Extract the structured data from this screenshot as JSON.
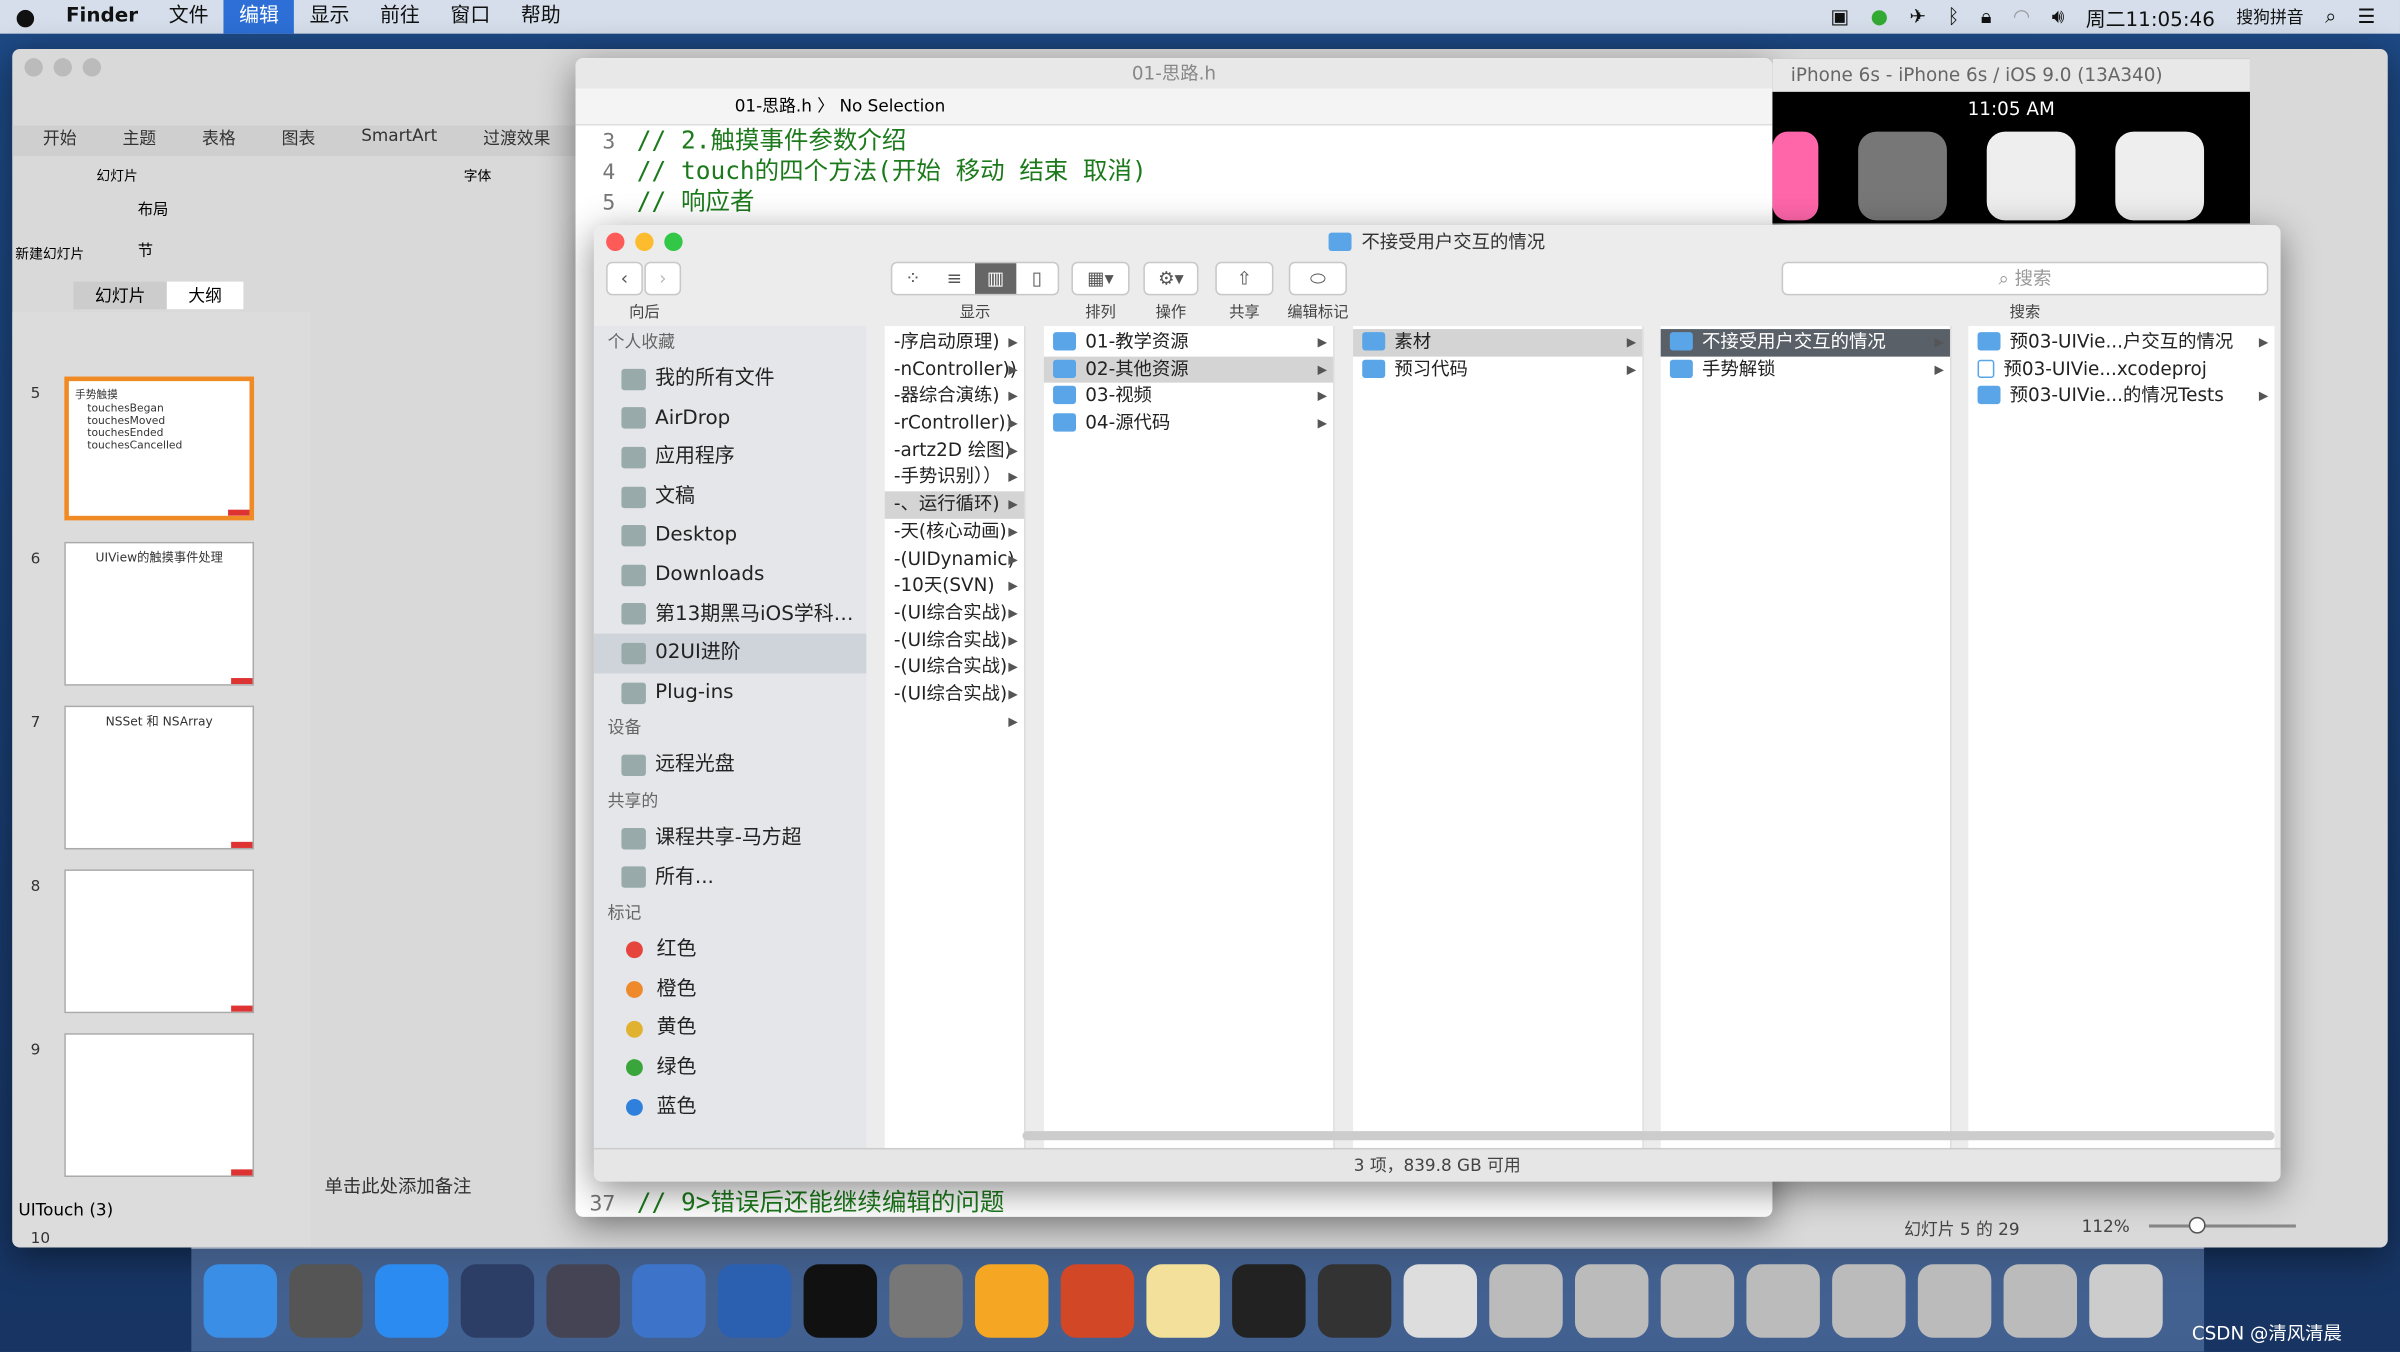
{
  "menubar": {
    "app": "Finder",
    "items": [
      "文件",
      "编辑",
      "显示",
      "前往",
      "窗口",
      "帮助"
    ],
    "selected": "编辑",
    "clock": "周二11:05:46",
    "input_method": "搜狗拼音"
  },
  "ppt": {
    "tabs": [
      "开始",
      "主题",
      "表格",
      "图表",
      "SmartArt",
      "过渡效果"
    ],
    "groups": [
      "幻灯片",
      "字体"
    ],
    "new_slide": "新建幻灯片",
    "layout": "布局",
    "section": "节",
    "view_tabs": [
      "幻灯片",
      "大纲"
    ],
    "slides": [
      {
        "num": "5",
        "title": "",
        "lines": [
          "手势触摸",
          "touchesBegan",
          "touchesMoved",
          "touchesEnded",
          "touchesCancelled"
        ]
      },
      {
        "num": "6",
        "title": "UIView的触摸事件处理",
        "lines": []
      },
      {
        "num": "7",
        "title": "NSSet 和 NSArray",
        "lines": []
      },
      {
        "num": "8",
        "title": "",
        "lines": []
      },
      {
        "num": "9",
        "title": "",
        "lines": []
      },
      {
        "num": "10",
        "title": "",
        "lines": []
      }
    ],
    "section_label": "UITouch (3)",
    "notes_placeholder": "单击此处添加备注",
    "status": "幻灯片 5 的 29",
    "zoom": "112%"
  },
  "xcode": {
    "title": "01-思路.h",
    "breadcrumb_file": "01-思路.h",
    "breadcrumb_sel": "No Selection",
    "lines": [
      {
        "n": "3",
        "t": "// 2.触摸事件参数介绍"
      },
      {
        "n": "4",
        "t": "// touch的四个方法(开始 移动 结束 取消)"
      },
      {
        "n": "5",
        "t": "// 响应者"
      },
      {
        "n": "37",
        "t": "// 9>错误后还能继续编辑的问题"
      }
    ]
  },
  "simulator": {
    "title": "iPhone 6s - iPhone 6s / iOS 9.0 (13A340)",
    "time": "11:05 AM"
  },
  "finder": {
    "title": "不接受用户交互的情况",
    "toolbar": {
      "back": "向后",
      "view": "显示",
      "arrange": "排列",
      "action": "操作",
      "share": "共享",
      "tags": "编辑标记",
      "search": "搜索",
      "search_placeholder": "搜索"
    },
    "sidebar": {
      "favorites_header": "个人收藏",
      "favorites": [
        "我的所有文件",
        "AirDrop",
        "应用程序",
        "文稿",
        "Desktop",
        "Downloads",
        "第13期黑马iOS学科…",
        "02UI进阶",
        "Plug-ins"
      ],
      "selected": "02UI进阶",
      "devices_header": "设备",
      "devices": [
        "远程光盘"
      ],
      "shared_header": "共享的",
      "shared": [
        "课程共享-马方超",
        "所有..."
      ],
      "tags_header": "标记",
      "tags": [
        {
          "name": "红色",
          "color": "#e5453c"
        },
        {
          "name": "橙色",
          "color": "#ef8a2c"
        },
        {
          "name": "黄色",
          "color": "#e0b230"
        },
        {
          "name": "绿色",
          "color": "#3aa53a"
        },
        {
          "name": "蓝色",
          "color": "#2f80dd"
        }
      ]
    },
    "col1": [
      "-序启动原理)",
      "-nController))",
      "-器综合演练)",
      "-rController))",
      "-artz2D 绘图)",
      "-手势识别））",
      "-、运行循环)",
      "-天(核心动画)",
      "-(UIDynamic)",
      "-10天(SVN)",
      "-(UI综合实战)",
      "-(UI综合实战)",
      "-(UI综合实战)",
      "-(UI综合实战)",
      ""
    ],
    "col1_selected": 6,
    "col2": [
      "01-教学资源",
      "02-其他资源",
      "03-视频",
      "04-源代码"
    ],
    "col2_selected": 1,
    "col3": [
      "素材",
      "预习代码"
    ],
    "col3_selected": 0,
    "col4": [
      "不接受用户交互的情况",
      "手势解锁"
    ],
    "col4_selected": 0,
    "col5": [
      {
        "name": "预03-UIVie...户交互的情况",
        "type": "folder"
      },
      {
        "name": "预03-UIVie...xcodeproj",
        "type": "file"
      },
      {
        "name": "预03-UIVie...的情况Tests",
        "type": "folder"
      }
    ],
    "status": "3 项，839.8 GB 可用"
  },
  "watermark": "CSDN @清风清晨"
}
